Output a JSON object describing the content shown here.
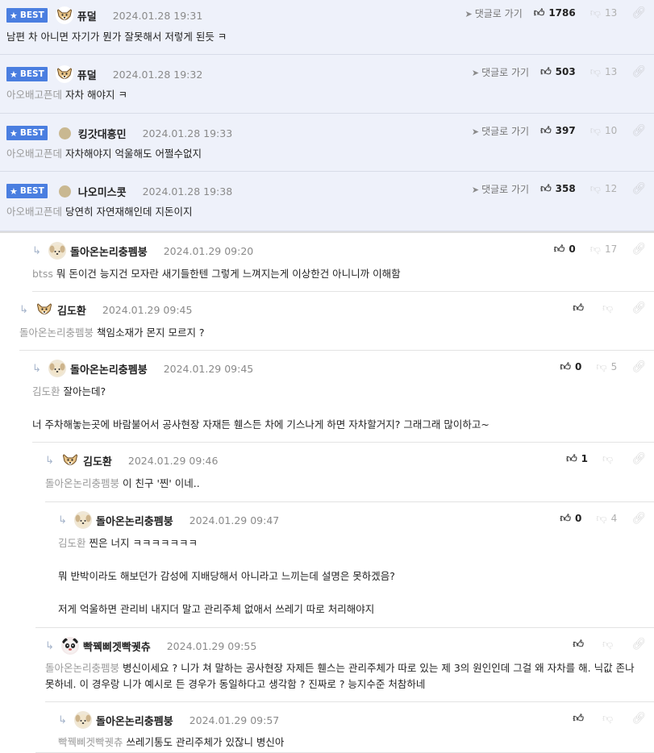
{
  "labels": {
    "best": "BEST",
    "goto": "댓글로 가기"
  },
  "comments": [
    {
      "best": true,
      "nick": "퓨덜",
      "avatar": "dog-icon",
      "date": "2024.01.28 19:31",
      "mention": "",
      "text": [
        "남편 차 아니면 자기가 뭔가 잘못해서 저렇게 된듯 ㅋ"
      ],
      "likes": "1786",
      "dislikes": "13"
    },
    {
      "best": true,
      "nick": "퓨덜",
      "avatar": "dog-icon",
      "date": "2024.01.28 19:32",
      "mention": "아오배고픈데",
      "text": [
        "자차 해야지 ㅋ"
      ],
      "likes": "503",
      "dislikes": "13"
    },
    {
      "best": true,
      "nick": "킹갓대흥민",
      "avatar": "dot",
      "date": "2024.01.28 19:33",
      "mention": "아오배고픈데",
      "text": [
        "자차해야지 억울해도 어쩔수없지"
      ],
      "likes": "397",
      "dislikes": "10"
    },
    {
      "best": true,
      "nick": "나오미스콧",
      "avatar": "dot",
      "date": "2024.01.28 19:38",
      "mention": "아오배고픈데",
      "text": [
        "당연히 자연재해인데 지돈이지"
      ],
      "likes": "358",
      "dislikes": "12"
    },
    {
      "best": false,
      "nick": "돌아온논리충펨붕",
      "avatar": "puppy-icon",
      "date": "2024.01.29 09:20",
      "mention": "btss",
      "text": [
        "뭐 돈이건 능지건 모자란 새기들한텐 그렇게 느껴지는게 이상한건 아니니까 이해함"
      ],
      "likes": "0",
      "dislikes": "17"
    },
    {
      "best": false,
      "nick": "김도환",
      "avatar": "dog-icon",
      "date": "2024.01.29 09:45",
      "mention": "돌아온논리충펨붕",
      "text": [
        "책임소재가 몬지 모르지 ?"
      ],
      "likes": "",
      "dislikes": ""
    },
    {
      "best": false,
      "nick": "돌아온논리충펨붕",
      "avatar": "puppy-icon",
      "date": "2024.01.29 09:45",
      "mention": "김도환",
      "text": [
        "잘아는데?",
        "",
        "너 주차해놓는곳에 바람불어서 공사현장 자재든 휀스든 차에 기스나게 하면 자차할거지? 그래그래 많이하고~"
      ],
      "likes": "0",
      "dislikes": "5"
    },
    {
      "best": false,
      "nick": "김도환",
      "avatar": "dog-icon",
      "date": "2024.01.29 09:46",
      "mention": "돌아온논리충펨붕",
      "text": [
        "이 친구 '찐' 이네.."
      ],
      "likes": "1",
      "dislikes": ""
    },
    {
      "best": false,
      "nick": "돌아온논리충펨붕",
      "avatar": "puppy-icon",
      "date": "2024.01.29 09:47",
      "mention": "김도환",
      "text": [
        "찐은 너지 ㅋㅋㅋㅋㅋㅋㅋ",
        "",
        "뭐 반박이라도 해보던가 감성에 지배당해서 아니라고 느끼는데 설명은 못하겠음?",
        "",
        "저게 억울하면 관리비 내지더 말고 관리주체 없애서 쓰레기 따로 처리해야지"
      ],
      "likes": "0",
      "dislikes": "4"
    },
    {
      "best": false,
      "nick": "빡꿱삐겟빡궷츄",
      "avatar": "panda-icon",
      "date": "2024.01.29 09:55",
      "mention": "돌아온논리충펨붕",
      "text": [
        "병신이세요 ? 니가 쳐 말하는 공사현장 자제든 휀스는 관리주체가 따로 있는 제 3의 원인인데 그걸 왜 자차를 해. 닉값 존나 못하네. 이 경우랑 니가 예시로 든 경우가 동일하다고 생각함 ? 진짜로 ? 능지수준 처참하네"
      ],
      "likes": "",
      "dislikes": ""
    },
    {
      "best": false,
      "nick": "돌아온논리충펨붕",
      "avatar": "puppy-icon",
      "date": "2024.01.29 09:57",
      "mention": "빡꿱삐겟빡궷츄",
      "text": [
        "쓰레기통도 관리주체가 있잖니 병신아"
      ],
      "likes": "",
      "dislikes": ""
    }
  ]
}
